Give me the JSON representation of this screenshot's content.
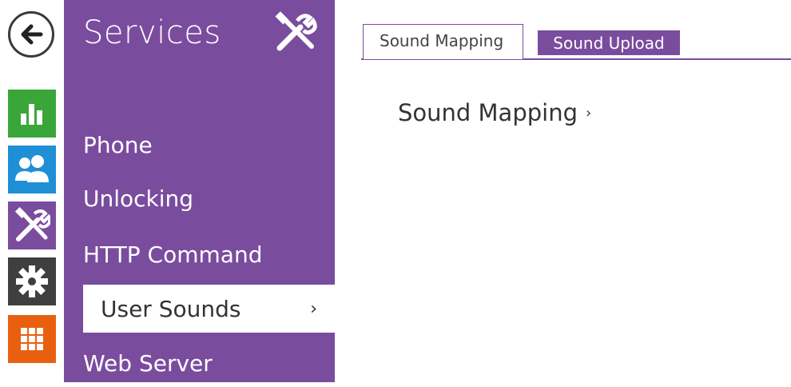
{
  "nav": {
    "back_icon": "arrow-left-icon",
    "rail": [
      {
        "icon": "bar-chart-icon",
        "color": "#3aa63a"
      },
      {
        "icon": "users-icon",
        "color": "#1f8fd6"
      },
      {
        "icon": "tools-icon",
        "color": "#7a4c9e"
      },
      {
        "icon": "gear-icon",
        "color": "#3f3f3f"
      },
      {
        "icon": "grid-icon",
        "color": "#e8600f"
      }
    ]
  },
  "menu": {
    "title": "Services",
    "title_icon": "tools-icon",
    "items": [
      {
        "label": "Phone"
      },
      {
        "label": "Unlocking"
      },
      {
        "label": "HTTP Command"
      },
      {
        "label": "User Sounds",
        "chevron": "›"
      },
      {
        "label": "Web Server"
      }
    ],
    "accent": "#7a4c9e"
  },
  "tabs": [
    {
      "label": "Sound Mapping"
    },
    {
      "label": "Sound Upload"
    }
  ],
  "content": {
    "heading": "Sound Mapping",
    "heading_chevron": "›"
  }
}
